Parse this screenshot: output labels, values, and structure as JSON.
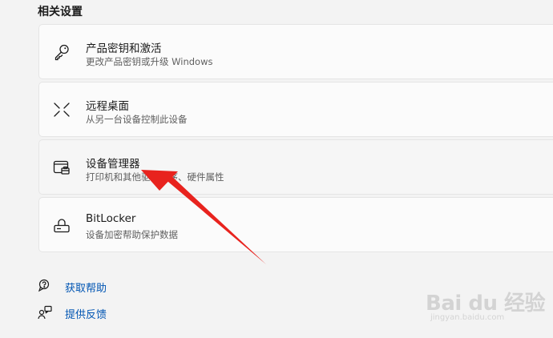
{
  "section": {
    "title": "相关设置"
  },
  "cards": [
    {
      "title": "产品密钥和激活",
      "subtitle": "更改产品密钥或升级 Windows",
      "icon": "key-icon"
    },
    {
      "title": "远程桌面",
      "subtitle": "从另一台设备控制此设备",
      "icon": "remote-desktop-icon"
    },
    {
      "title": "设备管理器",
      "subtitle": "打印机和其他驱动程序、硬件属性",
      "icon": "device-manager-icon"
    },
    {
      "title": "BitLocker",
      "subtitle": "设备加密帮助保护数据",
      "icon": "lock-icon"
    }
  ],
  "links": {
    "help": {
      "label": "获取帮助",
      "icon": "help-icon"
    },
    "feedback": {
      "label": "提供反馈",
      "icon": "feedback-icon"
    }
  },
  "annotation": {
    "arrow_color": "#e8231e"
  },
  "watermark": {
    "main": "Bai du 经验",
    "sub": "jingyan.baidu.com"
  },
  "colors": {
    "link": "#0055b3",
    "background": "#f3f3f3",
    "card": "#fbfbfb"
  }
}
